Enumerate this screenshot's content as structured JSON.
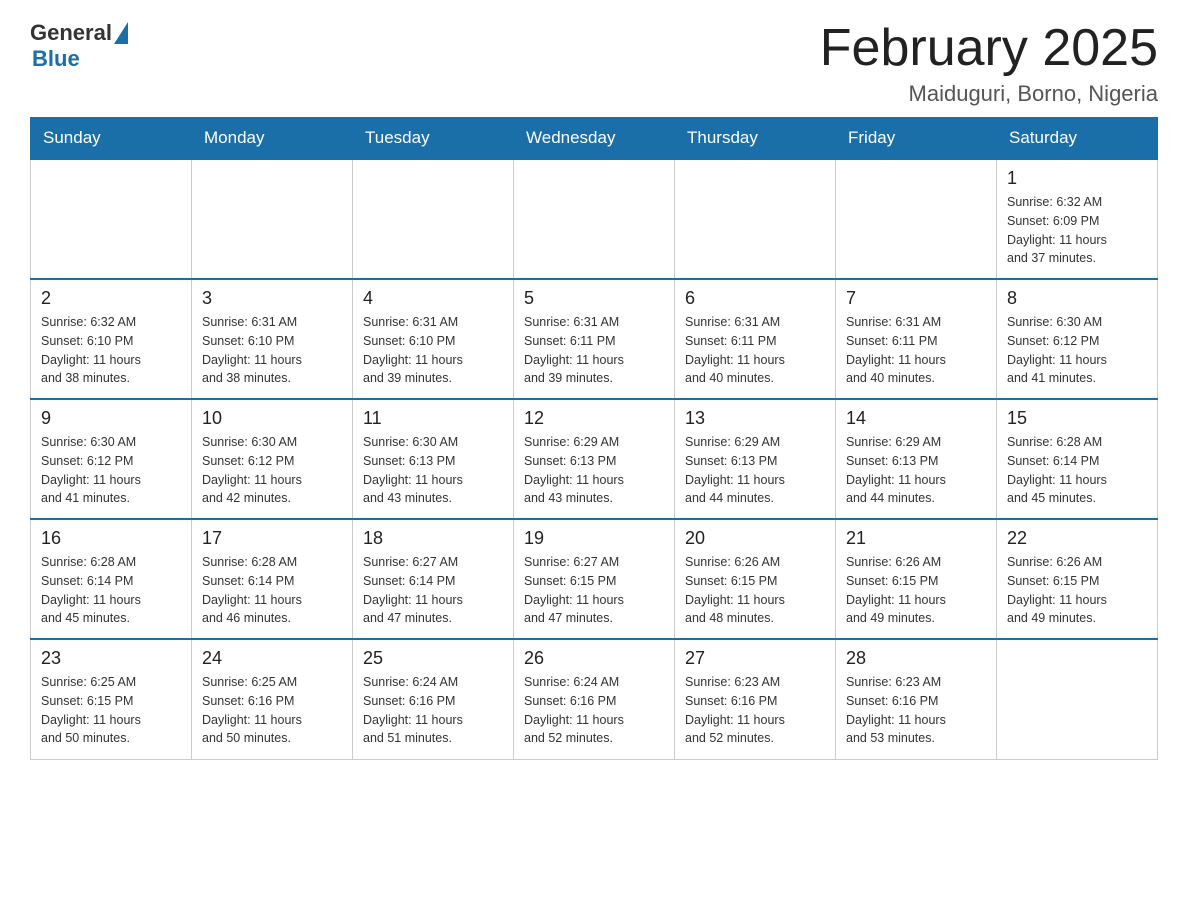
{
  "header": {
    "logo_general": "General",
    "logo_blue": "Blue",
    "month_title": "February 2025",
    "location": "Maiduguri, Borno, Nigeria"
  },
  "days_of_week": [
    "Sunday",
    "Monday",
    "Tuesday",
    "Wednesday",
    "Thursday",
    "Friday",
    "Saturday"
  ],
  "weeks": [
    [
      {
        "day": "",
        "info": ""
      },
      {
        "day": "",
        "info": ""
      },
      {
        "day": "",
        "info": ""
      },
      {
        "day": "",
        "info": ""
      },
      {
        "day": "",
        "info": ""
      },
      {
        "day": "",
        "info": ""
      },
      {
        "day": "1",
        "info": "Sunrise: 6:32 AM\nSunset: 6:09 PM\nDaylight: 11 hours\nand 37 minutes."
      }
    ],
    [
      {
        "day": "2",
        "info": "Sunrise: 6:32 AM\nSunset: 6:10 PM\nDaylight: 11 hours\nand 38 minutes."
      },
      {
        "day": "3",
        "info": "Sunrise: 6:31 AM\nSunset: 6:10 PM\nDaylight: 11 hours\nand 38 minutes."
      },
      {
        "day": "4",
        "info": "Sunrise: 6:31 AM\nSunset: 6:10 PM\nDaylight: 11 hours\nand 39 minutes."
      },
      {
        "day": "5",
        "info": "Sunrise: 6:31 AM\nSunset: 6:11 PM\nDaylight: 11 hours\nand 39 minutes."
      },
      {
        "day": "6",
        "info": "Sunrise: 6:31 AM\nSunset: 6:11 PM\nDaylight: 11 hours\nand 40 minutes."
      },
      {
        "day": "7",
        "info": "Sunrise: 6:31 AM\nSunset: 6:11 PM\nDaylight: 11 hours\nand 40 minutes."
      },
      {
        "day": "8",
        "info": "Sunrise: 6:30 AM\nSunset: 6:12 PM\nDaylight: 11 hours\nand 41 minutes."
      }
    ],
    [
      {
        "day": "9",
        "info": "Sunrise: 6:30 AM\nSunset: 6:12 PM\nDaylight: 11 hours\nand 41 minutes."
      },
      {
        "day": "10",
        "info": "Sunrise: 6:30 AM\nSunset: 6:12 PM\nDaylight: 11 hours\nand 42 minutes."
      },
      {
        "day": "11",
        "info": "Sunrise: 6:30 AM\nSunset: 6:13 PM\nDaylight: 11 hours\nand 43 minutes."
      },
      {
        "day": "12",
        "info": "Sunrise: 6:29 AM\nSunset: 6:13 PM\nDaylight: 11 hours\nand 43 minutes."
      },
      {
        "day": "13",
        "info": "Sunrise: 6:29 AM\nSunset: 6:13 PM\nDaylight: 11 hours\nand 44 minutes."
      },
      {
        "day": "14",
        "info": "Sunrise: 6:29 AM\nSunset: 6:13 PM\nDaylight: 11 hours\nand 44 minutes."
      },
      {
        "day": "15",
        "info": "Sunrise: 6:28 AM\nSunset: 6:14 PM\nDaylight: 11 hours\nand 45 minutes."
      }
    ],
    [
      {
        "day": "16",
        "info": "Sunrise: 6:28 AM\nSunset: 6:14 PM\nDaylight: 11 hours\nand 45 minutes."
      },
      {
        "day": "17",
        "info": "Sunrise: 6:28 AM\nSunset: 6:14 PM\nDaylight: 11 hours\nand 46 minutes."
      },
      {
        "day": "18",
        "info": "Sunrise: 6:27 AM\nSunset: 6:14 PM\nDaylight: 11 hours\nand 47 minutes."
      },
      {
        "day": "19",
        "info": "Sunrise: 6:27 AM\nSunset: 6:15 PM\nDaylight: 11 hours\nand 47 minutes."
      },
      {
        "day": "20",
        "info": "Sunrise: 6:26 AM\nSunset: 6:15 PM\nDaylight: 11 hours\nand 48 minutes."
      },
      {
        "day": "21",
        "info": "Sunrise: 6:26 AM\nSunset: 6:15 PM\nDaylight: 11 hours\nand 49 minutes."
      },
      {
        "day": "22",
        "info": "Sunrise: 6:26 AM\nSunset: 6:15 PM\nDaylight: 11 hours\nand 49 minutes."
      }
    ],
    [
      {
        "day": "23",
        "info": "Sunrise: 6:25 AM\nSunset: 6:15 PM\nDaylight: 11 hours\nand 50 minutes."
      },
      {
        "day": "24",
        "info": "Sunrise: 6:25 AM\nSunset: 6:16 PM\nDaylight: 11 hours\nand 50 minutes."
      },
      {
        "day": "25",
        "info": "Sunrise: 6:24 AM\nSunset: 6:16 PM\nDaylight: 11 hours\nand 51 minutes."
      },
      {
        "day": "26",
        "info": "Sunrise: 6:24 AM\nSunset: 6:16 PM\nDaylight: 11 hours\nand 52 minutes."
      },
      {
        "day": "27",
        "info": "Sunrise: 6:23 AM\nSunset: 6:16 PM\nDaylight: 11 hours\nand 52 minutes."
      },
      {
        "day": "28",
        "info": "Sunrise: 6:23 AM\nSunset: 6:16 PM\nDaylight: 11 hours\nand 53 minutes."
      },
      {
        "day": "",
        "info": ""
      }
    ]
  ]
}
